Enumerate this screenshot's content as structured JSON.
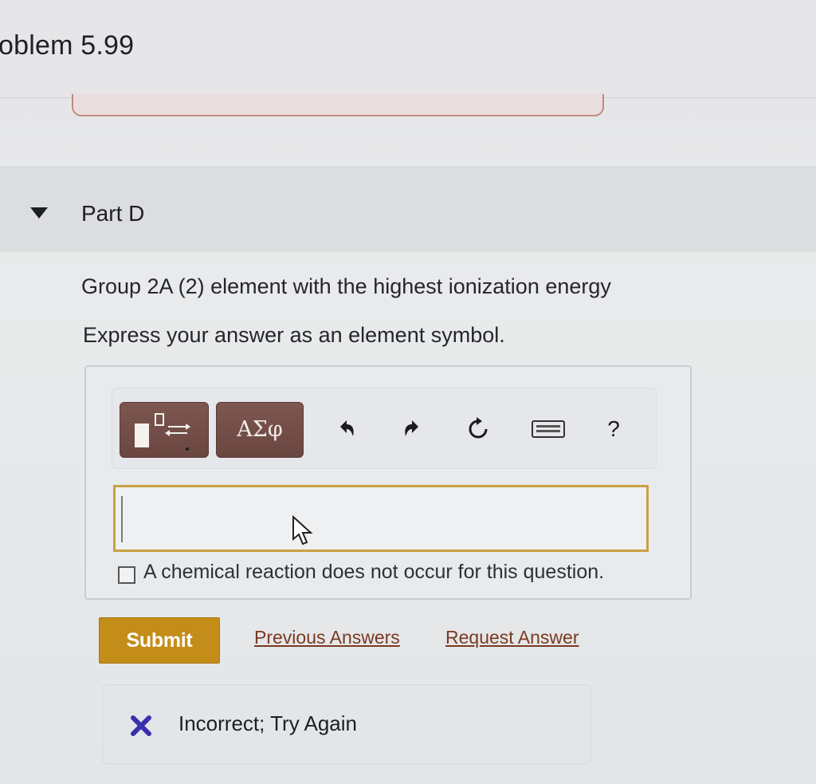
{
  "header": {
    "title": "oblem 5.99"
  },
  "part": {
    "label": "Part D"
  },
  "question": {
    "prompt": "Group 2A (2) element with the highest ionization energy",
    "instruction": "Express your answer as an element symbol."
  },
  "toolbar": {
    "symbols_label": "ΑΣφ",
    "help_label": "?",
    "icons": [
      "templates-icon",
      "undo-icon",
      "redo-icon",
      "reset-icon",
      "keyboard-icon",
      "help-icon"
    ]
  },
  "answer": {
    "value": "",
    "no_reaction_label": "A chemical reaction does not occur for this question."
  },
  "actions": {
    "submit_label": "Submit",
    "previous_answers_label": "Previous Answers",
    "request_answer_label": "Request Answer"
  },
  "feedback": {
    "status_text": "Incorrect; Try Again"
  },
  "colors": {
    "submit_bg": "#c48d19",
    "toolbar_button_bg": "#6f4a44",
    "input_border": "#c9a042",
    "incorrect_icon": "#3a2fae",
    "link": "#7b3a22"
  }
}
